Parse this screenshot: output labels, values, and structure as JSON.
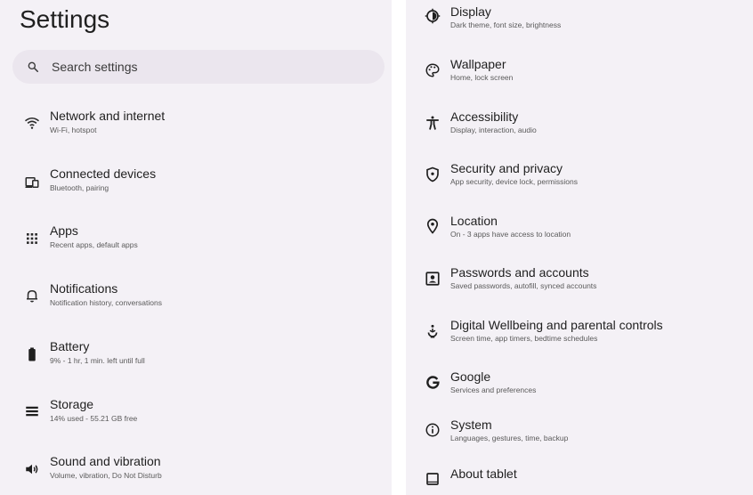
{
  "left": {
    "title": "Settings",
    "search": {
      "placeholder": "Search settings"
    },
    "items": [
      {
        "title": "Network and internet",
        "subtitle": "Wi-Fi, hotspot",
        "icon": "wifi-icon"
      },
      {
        "title": "Connected devices",
        "subtitle": "Bluetooth, pairing",
        "icon": "connected-devices-icon"
      },
      {
        "title": "Apps",
        "subtitle": "Recent apps, default apps",
        "icon": "apps-grid-icon"
      },
      {
        "title": "Notifications",
        "subtitle": "Notification history, conversations",
        "icon": "bell-icon"
      },
      {
        "title": "Battery",
        "subtitle": "9% - 1 hr, 1 min. left until full",
        "icon": "battery-icon"
      },
      {
        "title": "Storage",
        "subtitle": "14% used - 55.21 GB free",
        "icon": "storage-icon"
      },
      {
        "title": "Sound and vibration",
        "subtitle": "Volume, vibration, Do Not Disturb",
        "icon": "sound-icon"
      }
    ]
  },
  "right": {
    "items": [
      {
        "title": "Display",
        "subtitle": "Dark theme, font size, brightness",
        "icon": "display-brightness-icon"
      },
      {
        "title": "Wallpaper",
        "subtitle": "Home, lock screen",
        "icon": "palette-icon"
      },
      {
        "title": "Accessibility",
        "subtitle": "Display, interaction, audio",
        "icon": "accessibility-icon"
      },
      {
        "title": "Security and privacy",
        "subtitle": "App security, device lock, permissions",
        "icon": "shield-icon"
      },
      {
        "title": "Location",
        "subtitle": "On - 3 apps have access to location",
        "icon": "location-pin-icon"
      },
      {
        "title": "Passwords and accounts",
        "subtitle": "Saved passwords, autofill, synced accounts",
        "icon": "account-box-icon"
      },
      {
        "title": "Digital Wellbeing and parental controls",
        "subtitle": "Screen time, app timers, bedtime schedules",
        "icon": "wellbeing-icon"
      },
      {
        "title": "Google",
        "subtitle": "Services and preferences",
        "icon": "google-icon"
      },
      {
        "title": "System",
        "subtitle": "Languages, gestures, time, backup",
        "icon": "info-icon"
      },
      {
        "title": "About tablet",
        "subtitle": "",
        "icon": "tablet-icon"
      }
    ]
  }
}
